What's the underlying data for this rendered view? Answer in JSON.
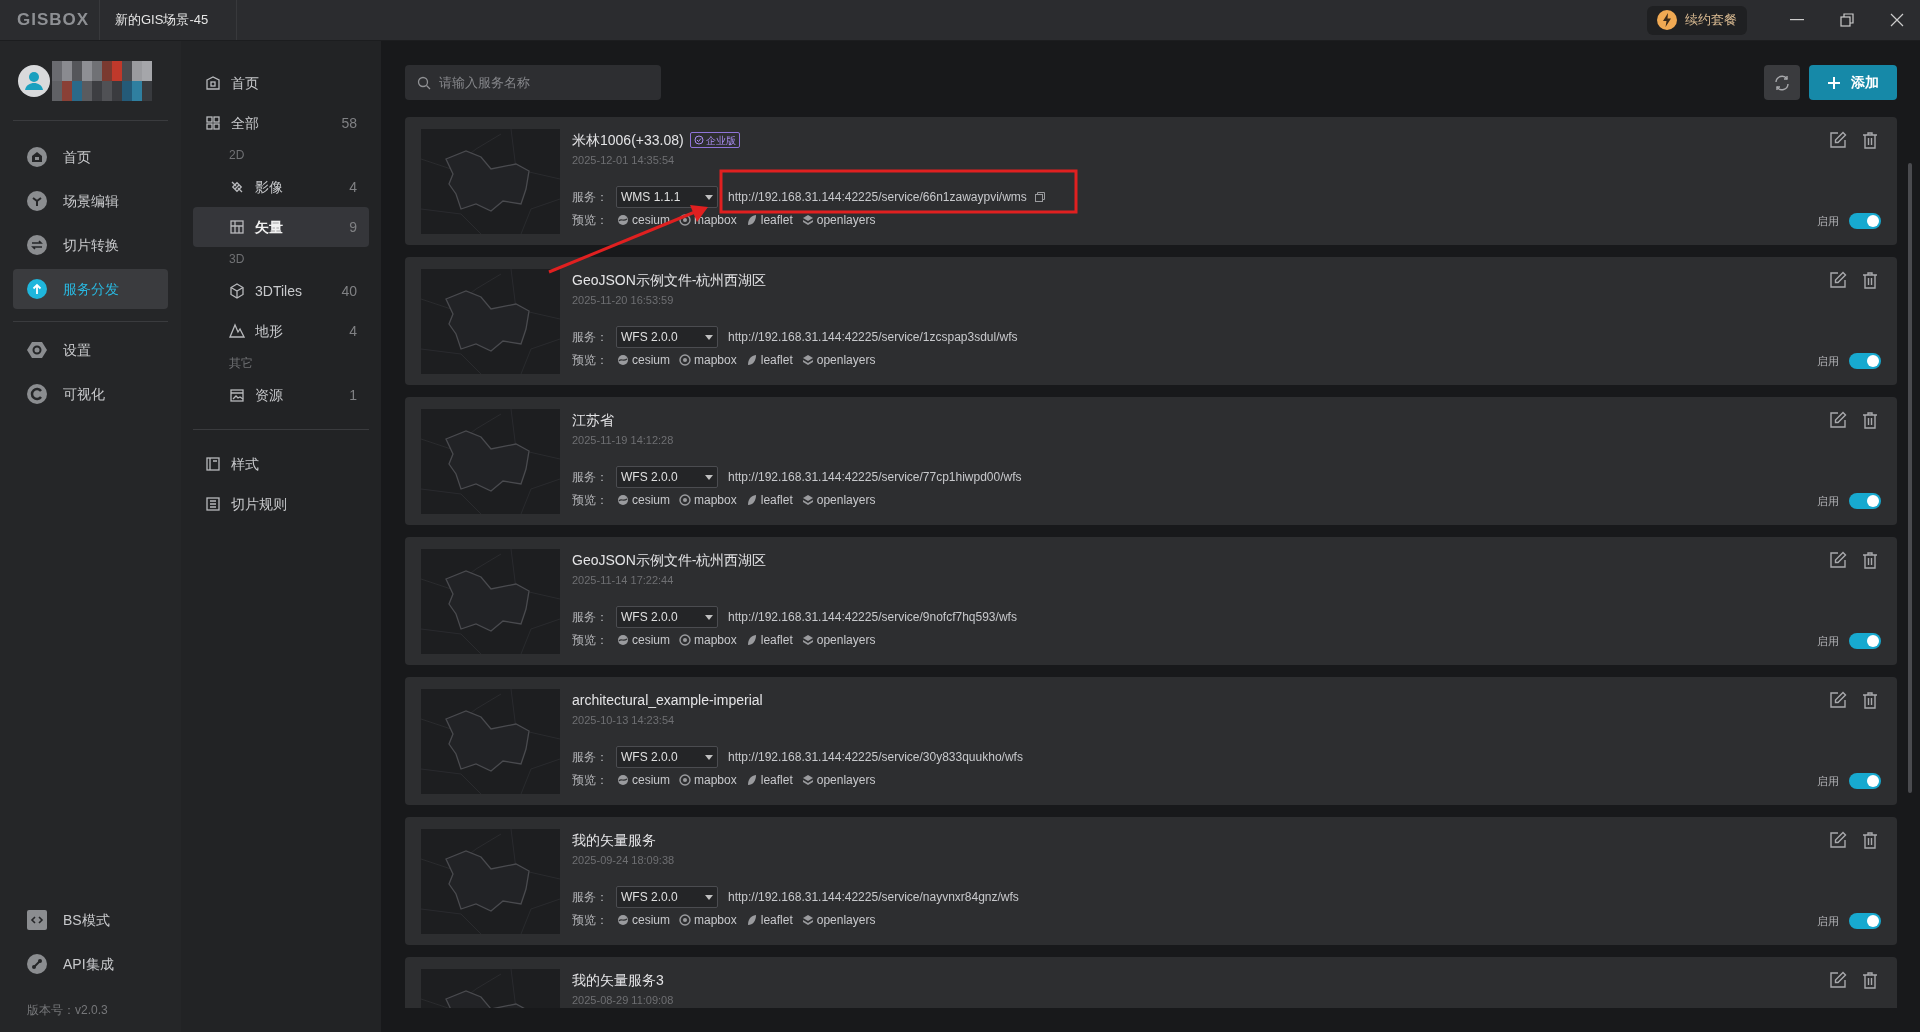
{
  "title_bar": {
    "logo": "GISBOX",
    "tab": "新的GIS场景-45",
    "renew_button": "续约套餐"
  },
  "sidebar": {
    "items": [
      {
        "label": "首页",
        "selected": false
      },
      {
        "label": "场景编辑",
        "selected": false
      },
      {
        "label": "切片转换",
        "selected": false
      },
      {
        "label": "服务分发",
        "selected": true
      },
      {
        "label": "设置",
        "selected": false
      },
      {
        "label": "可视化",
        "selected": false
      }
    ],
    "bottom_items": [
      {
        "label": "BS模式"
      },
      {
        "label": "API集成"
      }
    ],
    "version": "版本号：v2.0.3"
  },
  "categories": {
    "items": [
      {
        "kind": "item",
        "label": "首页",
        "selected": false
      },
      {
        "kind": "item",
        "label": "全部",
        "count": "58",
        "selected": false
      },
      {
        "kind": "heading",
        "label": "2D"
      },
      {
        "kind": "subitem",
        "label": "影像",
        "count": "4",
        "selected": false
      },
      {
        "kind": "subitem",
        "label": "矢量",
        "count": "9",
        "selected": true
      },
      {
        "kind": "heading",
        "label": "3D"
      },
      {
        "kind": "subitem",
        "label": "3DTiles",
        "count": "40",
        "selected": false
      },
      {
        "kind": "subitem",
        "label": "地形",
        "count": "4",
        "selected": false
      },
      {
        "kind": "heading",
        "label": "其它"
      },
      {
        "kind": "subitem",
        "label": "资源",
        "count": "1",
        "selected": false
      }
    ],
    "extra_items": [
      {
        "label": "样式"
      },
      {
        "label": "切片规则"
      }
    ]
  },
  "toolbar": {
    "search_placeholder": "请输入服务名称",
    "add_button": "添加"
  },
  "services": [
    {
      "title": "米林1006(+33.08)",
      "badge": "企业版",
      "date": "2025-12-01 14:35:54",
      "service_label": "服务：",
      "service_type": "WMS 1.1.1",
      "url": "http://192.168.31.144:42225/service/66n1zawaypvi/wms",
      "hovered": true,
      "preview_label": "预览：",
      "previews": [
        "cesium",
        "mapbox",
        "leaflet",
        "openlayers"
      ],
      "enabled_label": "启用",
      "enabled": true
    },
    {
      "title": "GeoJSON示例文件-杭州西湖区",
      "date": "2025-11-20 16:53:59",
      "service_label": "服务：",
      "service_type": "WFS 2.0.0",
      "url": "http://192.168.31.144:42225/service/1zcspap3sdul/wfs",
      "hovered": false,
      "preview_label": "预览：",
      "previews": [
        "cesium",
        "mapbox",
        "leaflet",
        "openlayers"
      ],
      "enabled_label": "启用",
      "enabled": true
    },
    {
      "title": "江苏省",
      "date": "2025-11-19 14:12:28",
      "service_label": "服务：",
      "service_type": "WFS 2.0.0",
      "url": "http://192.168.31.144:42225/service/77cp1hiwpd00/wfs",
      "hovered": false,
      "preview_label": "预览：",
      "previews": [
        "cesium",
        "mapbox",
        "leaflet",
        "openlayers"
      ],
      "enabled_label": "启用",
      "enabled": true
    },
    {
      "title": "GeoJSON示例文件-杭州西湖区",
      "date": "2025-11-14 17:22:44",
      "service_label": "服务：",
      "service_type": "WFS 2.0.0",
      "url": "http://192.168.31.144:42225/service/9nofcf7hq593/wfs",
      "hovered": false,
      "preview_label": "预览：",
      "previews": [
        "cesium",
        "mapbox",
        "leaflet",
        "openlayers"
      ],
      "enabled_label": "启用",
      "enabled": true
    },
    {
      "title": "architectural_example-imperial",
      "date": "2025-10-13 14:23:54",
      "service_label": "服务：",
      "service_type": "WFS 2.0.0",
      "url": "http://192.168.31.144:42225/service/30y833quukho/wfs",
      "hovered": false,
      "preview_label": "预览：",
      "previews": [
        "cesium",
        "mapbox",
        "leaflet",
        "openlayers"
      ],
      "enabled_label": "启用",
      "enabled": true
    },
    {
      "title": "我的矢量服务",
      "date": "2025-09-24 18:09:38",
      "service_label": "服务：",
      "service_type": "WFS 2.0.0",
      "url": "http://192.168.31.144:42225/service/nayvnxr84gnz/wfs",
      "hovered": false,
      "preview_label": "预览：",
      "previews": [
        "cesium",
        "mapbox",
        "leaflet",
        "openlayers"
      ],
      "enabled_label": "启用",
      "enabled": true
    },
    {
      "title": "我的矢量服务3",
      "date": "2025-08-29 11:09:08"
    }
  ]
}
